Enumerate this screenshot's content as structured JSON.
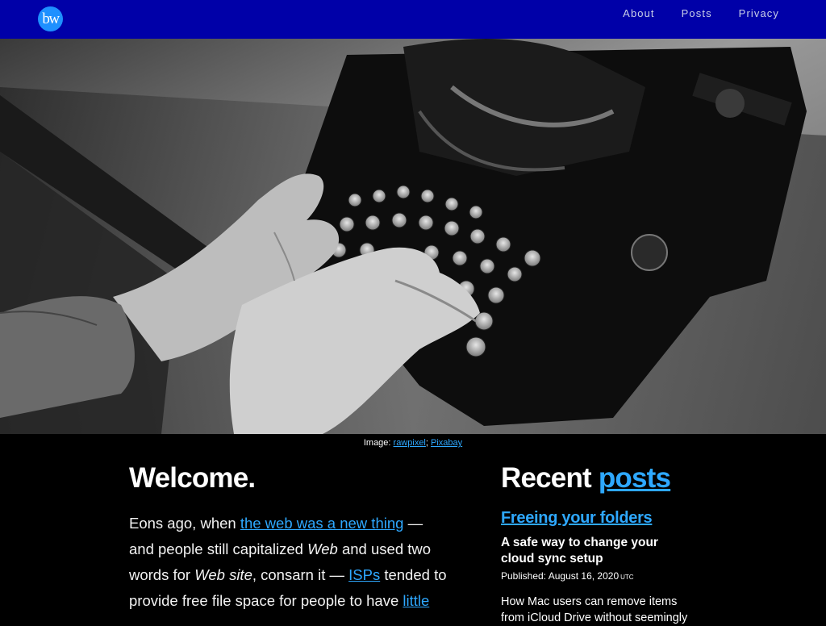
{
  "header": {
    "logo_text": "bw",
    "nav": [
      {
        "label": "About"
      },
      {
        "label": "Posts"
      },
      {
        "label": "Privacy"
      }
    ]
  },
  "hero": {
    "image_description": "black-and-white photo of hands typing on a vintage typewriter"
  },
  "caption": {
    "prefix": "Image: ",
    "credit": "rawpixel",
    "separator": "; ",
    "source": "Pixabay"
  },
  "welcome": {
    "title": "Welcome.",
    "p1": "Eons ago, when ",
    "link1": "the web was a new thing",
    "p2": " — and people still capitalized ",
    "em1": "Web",
    "p3": " and used two words for ",
    "em2": "Web site",
    "p4": ", consarn it — ",
    "link2": "ISPs",
    "p5": " tended to provide free file space for people to have ",
    "link3": "little"
  },
  "recent": {
    "title_prefix": "Recent ",
    "title_link": "posts",
    "post": {
      "title": "Freeing your folders",
      "subtitle": "A safe way to change your cloud sync setup",
      "date_label": "Published: August 16, 2020",
      "timezone": "UTC",
      "excerpt": "How Mac users can remove items from iCloud Drive without seemingly"
    }
  },
  "colors": {
    "header_bg": "#0000a8",
    "link": "#2ea8ff",
    "logo_bg": "#1e90ff",
    "page_bg": "#000000"
  }
}
